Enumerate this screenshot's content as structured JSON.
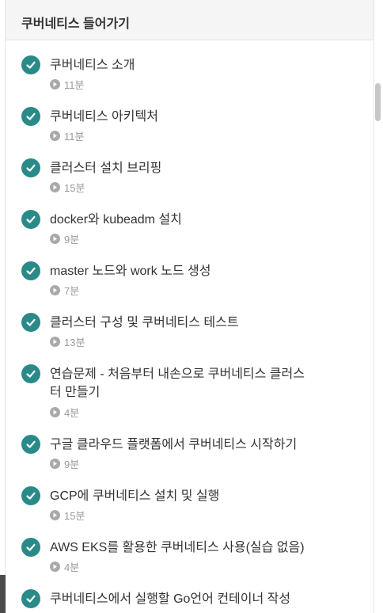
{
  "section": {
    "title": "쿠버네티스 들어가기"
  },
  "lessons": [
    {
      "title": "쿠버네티스 소개",
      "duration": "11분"
    },
    {
      "title": "쿠버네티스 아키텍처",
      "duration": "11분"
    },
    {
      "title": "클러스터 설치 브리핑",
      "duration": "15분"
    },
    {
      "title": "docker와 kubeadm 설치",
      "duration": "9분"
    },
    {
      "title": "master 노드와 work 노드 생성",
      "duration": "7분"
    },
    {
      "title": "클러스터 구성 및 쿠버네티스 테스트",
      "duration": "13분"
    },
    {
      "title": "연습문제 - 처음부터 내손으로 쿠버네티스 클러스터 만들기",
      "duration": "4분"
    },
    {
      "title": "구글 클라우드 플랫폼에서 쿠버네티스 시작하기",
      "duration": "9분"
    },
    {
      "title": "GCP에 쿠버네티스 설치 및 실행",
      "duration": "15분"
    },
    {
      "title": "AWS EKS를 활용한 쿠버네티스 사용(실습 없음)",
      "duration": "4분"
    },
    {
      "title": "쿠버네티스에서 실행할 Go언어 컨테이너 작성",
      "duration": ""
    }
  ],
  "colors": {
    "check": "#2a8a8a",
    "header_bg": "#f5f5f5",
    "duration_text": "#9a9a9a"
  }
}
